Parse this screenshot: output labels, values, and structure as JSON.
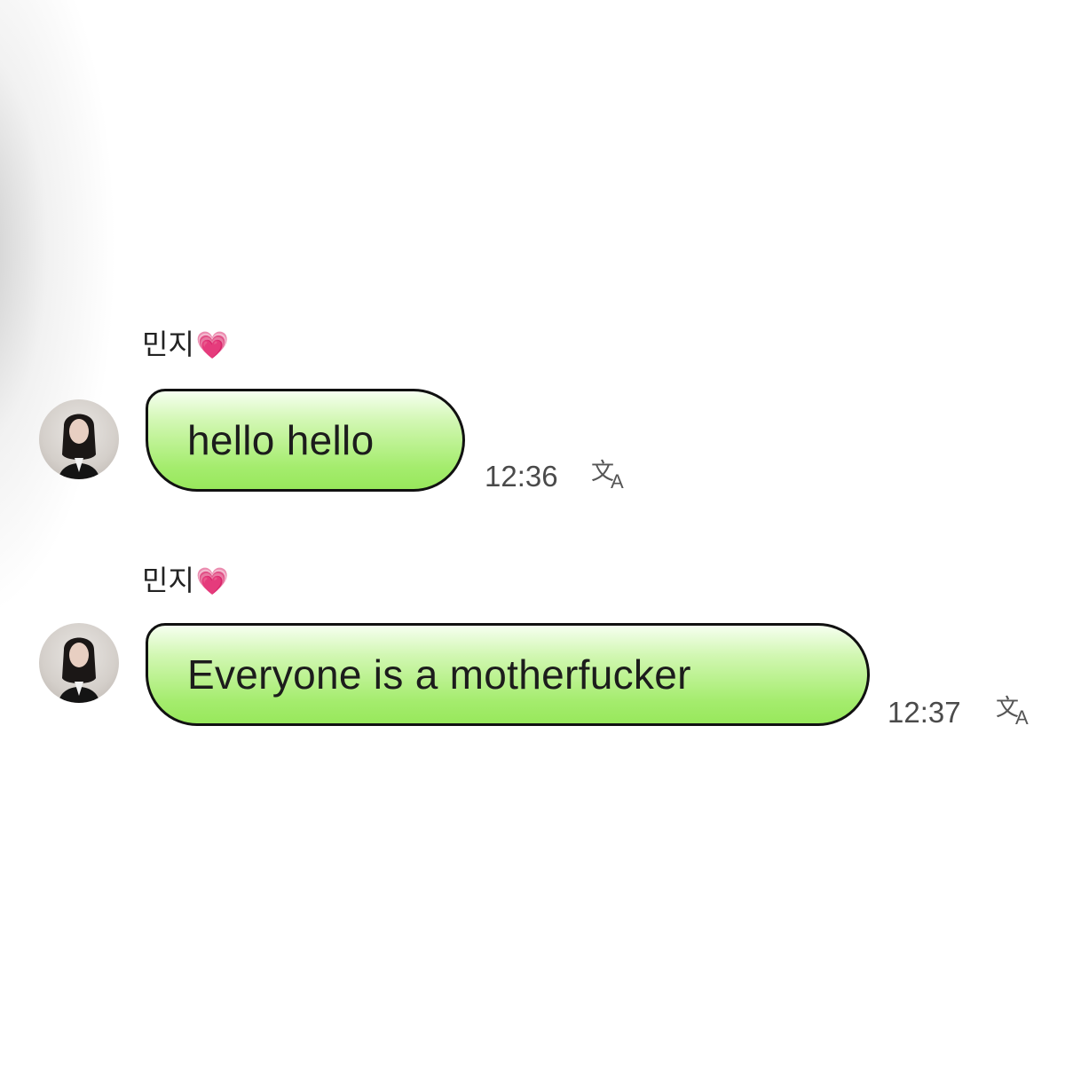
{
  "messages": [
    {
      "sender": "민지",
      "sender_emoji": "💗",
      "text": "hello hello",
      "time": "12:36",
      "icon": "translate-icon"
    },
    {
      "sender": "민지",
      "sender_emoji": "💗",
      "text": "Everyone is a motherfucker",
      "time": "12:37",
      "icon": "translate-icon"
    }
  ],
  "colors": {
    "bubble_green": "#a4ec6d",
    "bubble_border": "#111111",
    "heart": "#f25aa8"
  }
}
